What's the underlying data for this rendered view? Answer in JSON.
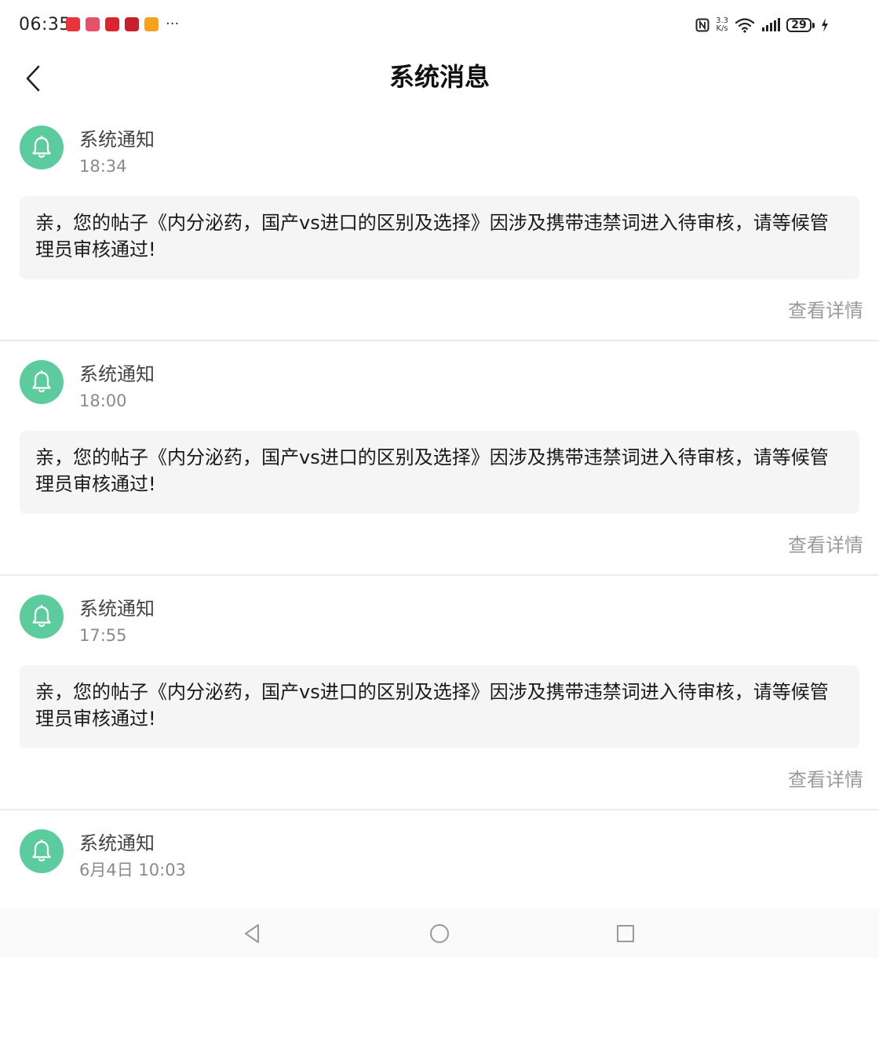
{
  "status_bar": {
    "time": "06:35",
    "overflow": "···",
    "notification_app_colors": [
      "#e8343a",
      "#e8506a",
      "#d8262c",
      "#c8202a",
      "#f4a21c"
    ],
    "net_speed_value": "3.3",
    "net_speed_unit": "K/s",
    "battery_level": "29",
    "icons": [
      "nfc-icon",
      "wifi-icon",
      "signal-icon",
      "battery-icon",
      "charging-icon"
    ]
  },
  "header": {
    "title": "系统消息",
    "back_icon": "chevron-left-icon"
  },
  "messages": [
    {
      "sender": "系统通知",
      "time": "18:34",
      "body": "亲，您的帖子《内分泌药，国产vs进口的区别及选择》因涉及携带违禁词进入待审核，请等候管理员审核通过!",
      "detail_label": "查看详情"
    },
    {
      "sender": "系统通知",
      "time": "18:00",
      "body": "亲，您的帖子《内分泌药，国产vs进口的区别及选择》因涉及携带违禁词进入待审核，请等候管理员审核通过!",
      "detail_label": "查看详情"
    },
    {
      "sender": "系统通知",
      "time": "17:55",
      "body": "亲，您的帖子《内分泌药，国产vs进口的区别及选择》因涉及携带违禁词进入待审核，请等候管理员审核通过!",
      "detail_label": "查看详情"
    },
    {
      "sender": "系统通知",
      "time": "6月4日 10:03"
    }
  ],
  "colors": {
    "accent": "#5ccc9f",
    "bubble_bg": "#f5f5f5",
    "muted_text": "#9a9a9a"
  },
  "bottom_nav": {
    "icons": [
      "back-triangle-icon",
      "home-circle-icon",
      "recents-square-icon"
    ]
  }
}
